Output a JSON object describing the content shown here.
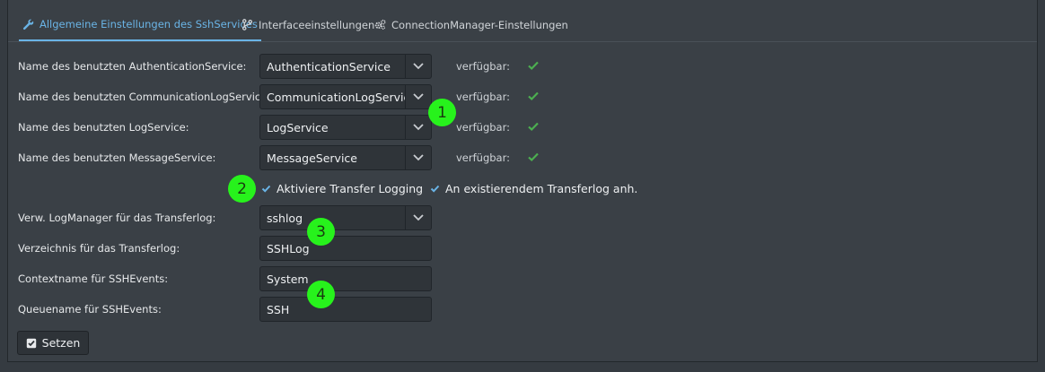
{
  "tabs": [
    {
      "label": "Allgemeine Einstellungen des SshServices",
      "active": true
    },
    {
      "label": "Interfaceeinstellungen",
      "active": false
    },
    {
      "label": "ConnectionManager-Einstellungen",
      "active": false
    }
  ],
  "services": [
    {
      "label": "Name des benutzten AuthenticationService:",
      "value": "AuthenticationService",
      "status_label": "verfügbar:"
    },
    {
      "label": "Name des benutzten CommunicationLogService:",
      "value": "CommunicationLogService",
      "status_label": "verfügbar:"
    },
    {
      "label": "Name des benutzten LogService:",
      "value": "LogService",
      "status_label": "verfügbar:"
    },
    {
      "label": "Name des benutzten MessageService:",
      "value": "MessageService",
      "status_label": "verfügbar:"
    }
  ],
  "checkboxes": {
    "transfer_logging": {
      "label": "Aktiviere Transfer Logging",
      "checked": true
    },
    "append_transferlog": {
      "label": "An existierendem Transferlog anh.",
      "checked": true
    }
  },
  "logmanager": {
    "label": "Verw. LogManager für das Transferlog:",
    "value": "sshlog"
  },
  "directory": {
    "label": "Verzeichnis für das Transferlog:",
    "value": "SSHLog"
  },
  "contextname": {
    "label": "Contextname für SSHEvents:",
    "value": "System"
  },
  "queuename": {
    "label": "Queuename für SSHEvents:",
    "value": "SSH"
  },
  "submit_label": "Setzen",
  "markers": [
    "1",
    "2",
    "3",
    "4"
  ],
  "colors": {
    "accent": "#6ab4e6",
    "ok": "#4caf50",
    "marker": "#27f21c"
  },
  "icons": {
    "tab0": "wrench-icon",
    "tab1": "branch-icon",
    "tab2": "cogs-icon",
    "status": "checkmark-icon",
    "dropdown": "chevron-down-icon"
  }
}
